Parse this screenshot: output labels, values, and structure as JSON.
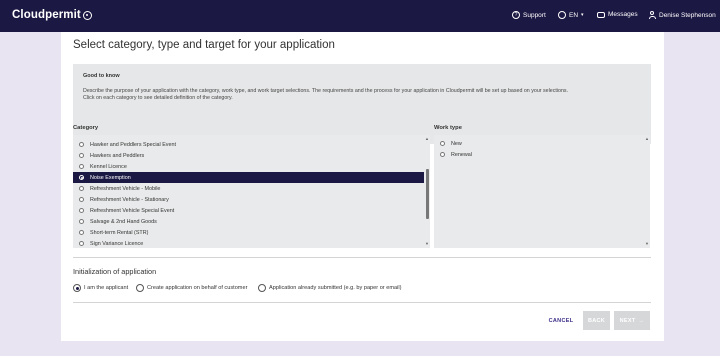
{
  "header": {
    "brand": "Cloudpermit",
    "support": "Support",
    "language": "EN",
    "messages": "Messages",
    "user": "Denise Stephenson"
  },
  "page": {
    "title": "Select category, type and target for your application"
  },
  "info": {
    "title": "Good to know",
    "line1": "Describe the purpose of your application with the category, work type, and work target selections. The requirements and the process for your application in Cloudpermit will be set up based on your selections.",
    "line2": "Click on each category to see detailed definition of the category."
  },
  "category": {
    "label": "Category",
    "options": [
      {
        "label": "Hawker and Peddlers Special Event",
        "selected": false
      },
      {
        "label": "Hawkers and Peddlers",
        "selected": false
      },
      {
        "label": "Kennel Licence",
        "selected": false
      },
      {
        "label": "Noise Exemption",
        "selected": true
      },
      {
        "label": "Refreshment Vehicle - Mobile",
        "selected": false
      },
      {
        "label": "Refreshment Vehicle - Stationary",
        "selected": false
      },
      {
        "label": "Refreshment Vehicle Special Event",
        "selected": false
      },
      {
        "label": "Salvage & 2nd Hand Goods",
        "selected": false
      },
      {
        "label": "Short-term Rental (STR)",
        "selected": false
      },
      {
        "label": "Sign Variance Licence",
        "selected": false
      }
    ],
    "scroll_position": 0.55
  },
  "work_type": {
    "label": "Work type",
    "options": [
      {
        "label": "New"
      },
      {
        "label": "Renewal"
      }
    ]
  },
  "initialization": {
    "title": "Initialization of application",
    "options": [
      {
        "label": "I am the applicant",
        "checked": true
      },
      {
        "label": "Create application on behalf of customer",
        "checked": false
      },
      {
        "label": "Application already submitted (e.g. by paper or email)",
        "checked": false
      }
    ]
  },
  "actions": {
    "cancel": "CANCEL",
    "back": "BACK",
    "next": "NEXT",
    "next_arrow": "→"
  },
  "colors": {
    "header_bg": "#1c1844",
    "page_bg": "#e9e4f2",
    "accent": "#3b2e86",
    "disabled_btn": "#d6d7d9"
  }
}
